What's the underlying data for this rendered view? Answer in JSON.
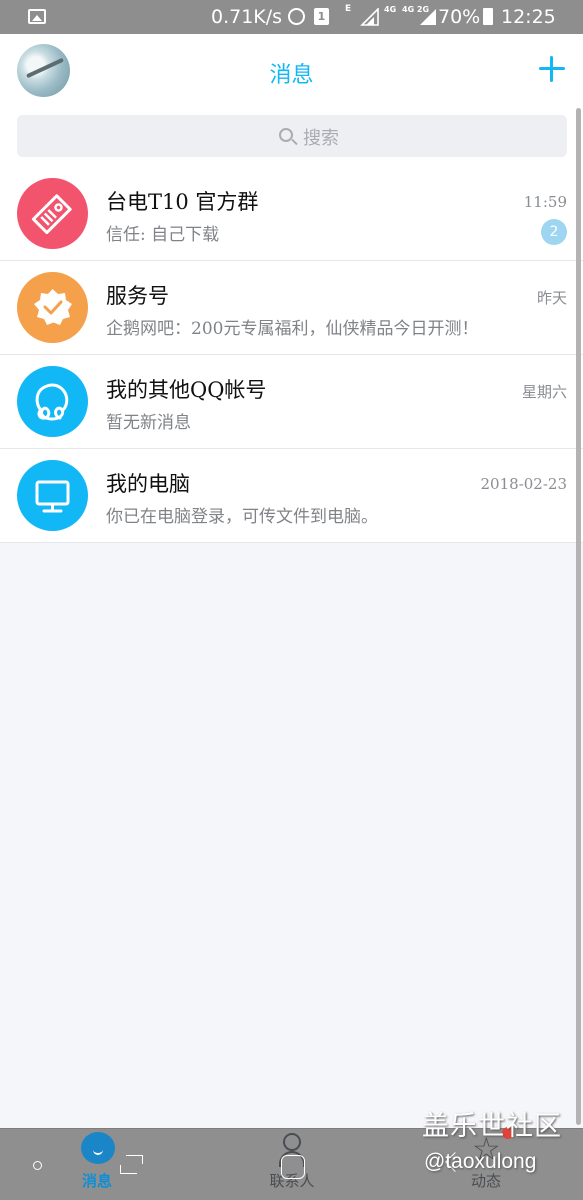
{
  "status_bar": {
    "network_speed": "0.71K/s",
    "sim_slot": "1",
    "network_type_1": "E",
    "network_type_2": "4G",
    "network_type_3": "4G 2G",
    "battery": "70%",
    "time": "12:25"
  },
  "header": {
    "title": "消息",
    "add_icon": "plus-icon"
  },
  "search": {
    "placeholder": "搜索"
  },
  "conversations": [
    {
      "name": "台电T10 官方群",
      "preview": "信任: 自己下载",
      "time": "11:59",
      "unread": "2",
      "avatar_color": "#f2546e",
      "icon": "tag-icon"
    },
    {
      "name": "服务号",
      "preview": "企鹅网吧：200元专属福利，仙侠精品今日开测！",
      "time": "昨天",
      "avatar_color": "#f5a04a",
      "icon": "verified-badge-icon"
    },
    {
      "name": "我的其他QQ帐号",
      "preview": "暂无新消息",
      "time": "星期六",
      "avatar_color": "#12b7f5",
      "icon": "linked-accounts-icon"
    },
    {
      "name": "我的电脑",
      "preview": "你已在电脑登录，可传文件到电脑。",
      "time": "2018-02-23",
      "avatar_color": "#12b7f5",
      "icon": "monitor-icon"
    }
  ],
  "tabs": {
    "messages": "消息",
    "contacts": "联系人",
    "feeds": "动态"
  },
  "watermark": {
    "title": "盖乐世社区",
    "user": "@taoxulong"
  },
  "colors": {
    "accent": "#12b7f5",
    "badge": "#9ed6f2"
  }
}
